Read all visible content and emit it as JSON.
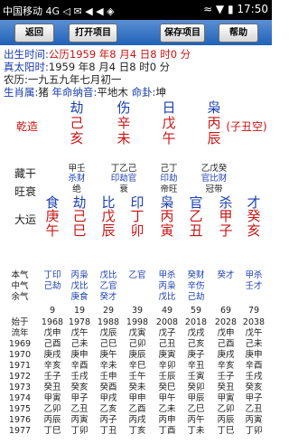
{
  "status": {
    "carrier": "中国移动 4G",
    "icons": "◁ ✉ ◀ ◀ ◈",
    "time": "17:50",
    "signal_icons": "≈ ▼ ▮"
  },
  "toolbar": {
    "back": "返回",
    "open": "打开项目",
    "save": "保存项目",
    "help": "帮助"
  },
  "info": {
    "birth_label": "出生时间:",
    "birth_value": "公历1959 年8 月4 日8 时0 分",
    "solar_label": "真太阳时:",
    "solar_value": "1959 年8 月4 日8 时0 分",
    "lunar_label": "农历:",
    "lunar_value": "一九五九年七月初一",
    "zodiac_label": "生肖属:",
    "zodiac_value": "猪",
    "nayin_label": "年命纳音:",
    "nayin_value": "平地木",
    "gua_label": "命卦:",
    "gua_value": "坤"
  },
  "pillars": {
    "shishen": [
      "劫",
      "伤",
      "日",
      "枭"
    ],
    "label": "乾造",
    "stems": [
      "己",
      "辛",
      "戊",
      "丙"
    ],
    "branches": [
      "亥",
      "未",
      "午",
      "辰"
    ],
    "kong": "(子丑空)"
  },
  "canggan": {
    "label": "藏干",
    "stems": [
      "甲壬",
      "丁乙己",
      "己丁",
      "乙戊癸"
    ],
    "gods": [
      "杀财",
      "印劫官",
      "印劫",
      "官比财"
    ],
    "wang_label": "旺衰",
    "wang": [
      "绝",
      "衰",
      "帝旺",
      "冠带"
    ]
  },
  "dayun": {
    "label": "大运",
    "gods": [
      "食",
      "劫",
      "比",
      "印",
      "枭",
      "官",
      "杀",
      "才"
    ],
    "stems": [
      "庚",
      "己",
      "戊",
      "丁",
      "丙",
      "乙",
      "甲",
      "癸"
    ],
    "branches": [
      "午",
      "巳",
      "辰",
      "卯",
      "寅",
      "丑",
      "子",
      "亥"
    ],
    "ben_label": "本气",
    "zhong_label": "中气",
    "yu_label": "余气",
    "ben": [
      "丁印",
      "丙枭",
      "戊比",
      "乙官",
      "甲杀",
      "癸财",
      "癸才",
      "甲杀"
    ],
    "zhong": [
      "己劫",
      "戊比",
      "乙官",
      "",
      "丙枭",
      "辛伤",
      "",
      "壬才"
    ],
    "yu": [
      "",
      "庚食",
      "癸才",
      "",
      "戊比",
      "己劫",
      "",
      ""
    ],
    "ages_row": [
      "9",
      "19",
      "29",
      "39",
      "49",
      "59",
      "69",
      "79"
    ],
    "start_label": "始于",
    "start_years": [
      "1968",
      "1978",
      "1988",
      "1998",
      "2008",
      "2018",
      "2028",
      "2038"
    ]
  },
  "liunian": {
    "label": "流年",
    "first_row": [
      "戊申",
      "戊午",
      "戊辰",
      "戊寅",
      "戊子",
      "戊戌",
      "戊申",
      "戊午"
    ],
    "years": [
      "1969",
      "1970",
      "1971",
      "1972",
      "1973",
      "1974",
      "1975",
      "1976",
      "1977"
    ],
    "rows": [
      [
        "己酉",
        "己未",
        "己巳",
        "己卯",
        "己丑",
        "己亥",
        "己酉",
        "己未"
      ],
      [
        "庚戌",
        "庚申",
        "庚午",
        "庚辰",
        "庚寅",
        "庚子",
        "庚戌",
        "庚申"
      ],
      [
        "辛亥",
        "辛酉",
        "辛未",
        "辛巳",
        "辛卯",
        "辛丑",
        "辛亥",
        "辛酉"
      ],
      [
        "壬子",
        "壬戌",
        "壬申",
        "壬午",
        "壬辰",
        "壬寅",
        "壬子",
        "壬戌"
      ],
      [
        "癸丑",
        "癸亥",
        "癸酉",
        "癸未",
        "癸巳",
        "癸卯",
        "癸丑",
        "癸亥"
      ],
      [
        "甲寅",
        "甲子",
        "甲戌",
        "甲申",
        "甲午",
        "甲辰",
        "甲寅",
        "甲子"
      ],
      [
        "乙卯",
        "乙丑",
        "乙亥",
        "乙酉",
        "乙未",
        "乙巳",
        "乙卯",
        "乙丑"
      ],
      [
        "丙辰",
        "丙寅",
        "丙子",
        "丙戌",
        "丙申",
        "丙午",
        "丙辰",
        "丙寅"
      ],
      [
        "丁巳",
        "丁卯",
        "丁丑",
        "丁亥",
        "丁酉",
        "丁未",
        "丁巳",
        "丁卯"
      ]
    ]
  }
}
